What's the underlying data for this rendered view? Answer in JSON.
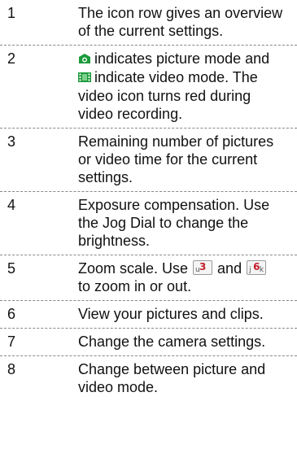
{
  "rows": [
    {
      "number": "1",
      "text": "The icon row gives an overview of the current settings."
    },
    {
      "number": "2",
      "part1": "indicates picture mode and",
      "part2": "indicate video mode. The video icon turns red during video recording.",
      "icons": [
        "camera-icon",
        "video-icon"
      ]
    },
    {
      "number": "3",
      "text": "Remaining number of pictures or video time for the current settings."
    },
    {
      "number": "4",
      "text": "Exposure compensation. Use the Jog Dial to change the brightness."
    },
    {
      "number": "5",
      "part1": "Zoom scale. Use",
      "and": "and",
      "part2": "to zoom in or out.",
      "key3": {
        "main": "3",
        "sub": "u"
      },
      "key6": {
        "main": "6",
        "sub": "j",
        "sub2": "k"
      }
    },
    {
      "number": "6",
      "text": "View your pictures and clips."
    },
    {
      "number": "7",
      "text": "Change the camera settings."
    },
    {
      "number": "8",
      "text": "Change between picture and video mode."
    }
  ],
  "colors": {
    "camera_icon": "#1a9a3a",
    "video_icon": "#1a9a3a",
    "key_digit": "#c21e2a"
  }
}
